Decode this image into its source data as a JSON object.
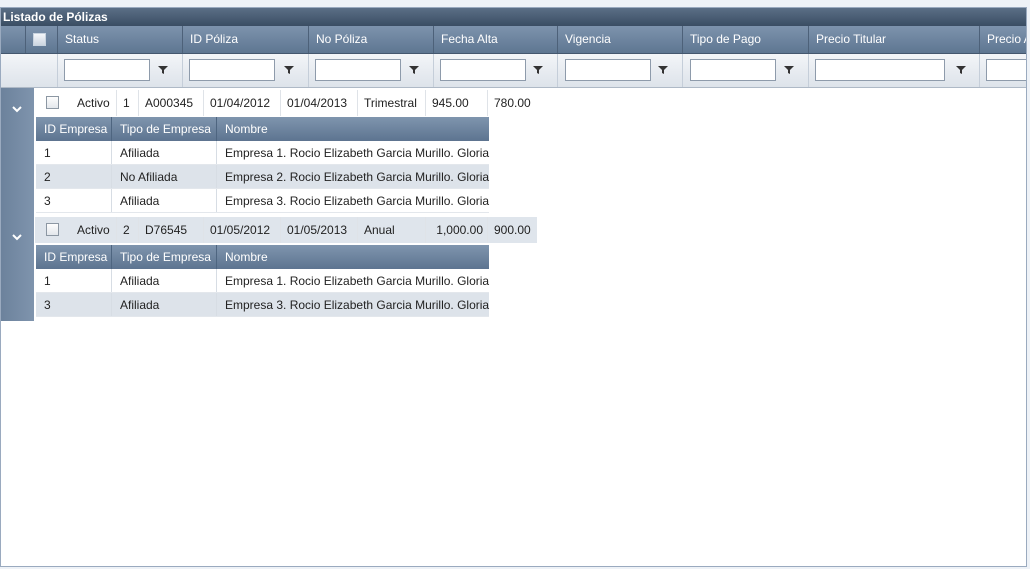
{
  "panel_title": "Listado de Pólizas",
  "columns": [
    "Status",
    "ID Póliza",
    "No Póliza",
    "Fecha Alta",
    "Vigencia",
    "Tipo de Pago",
    "Precio Titular",
    "Precio A"
  ],
  "filter_icon": "filter-funnel-icon",
  "expander_icon": "chevron-down-icon",
  "rows": [
    {
      "status": "Activo",
      "num": "1",
      "id": "A000345",
      "alta": "01/04/2012",
      "vigencia": "01/04/2013",
      "pago": "Trimestral",
      "precio_titular": "945.00",
      "precio_a": "780.00"
    },
    {
      "status": "Activo",
      "num": "2",
      "id": "D76545",
      "alta": "01/05/2012",
      "vigencia": "01/05/2013",
      "pago": "Anual",
      "precio_titular": "1,000.00",
      "precio_a": "900.00"
    }
  ],
  "sub_headers": [
    "ID Empresa",
    "Tipo de Empresa",
    "Nombre"
  ],
  "sub1": [
    {
      "id": "1",
      "tipo": "Afiliada",
      "nombre": "Empresa 1. Rocio Elizabeth Garcia Murillo. Gloria"
    },
    {
      "id": "2",
      "tipo": "No Afiliada",
      "nombre": "Empresa 2. Rocio Elizabeth Garcia Murillo. Gloria"
    },
    {
      "id": "3",
      "tipo": "Afiliada",
      "nombre": "Empresa 3. Rocio Elizabeth Garcia Murillo. Gloria"
    }
  ],
  "sub2": [
    {
      "id": "1",
      "tipo": "Afiliada",
      "nombre": "Empresa 1. Rocio Elizabeth Garcia Murillo. Gloria"
    },
    {
      "id": "3",
      "tipo": "Afiliada",
      "nombre": "Empresa 3. Rocio Elizabeth Garcia Murillo. Gloria"
    }
  ]
}
